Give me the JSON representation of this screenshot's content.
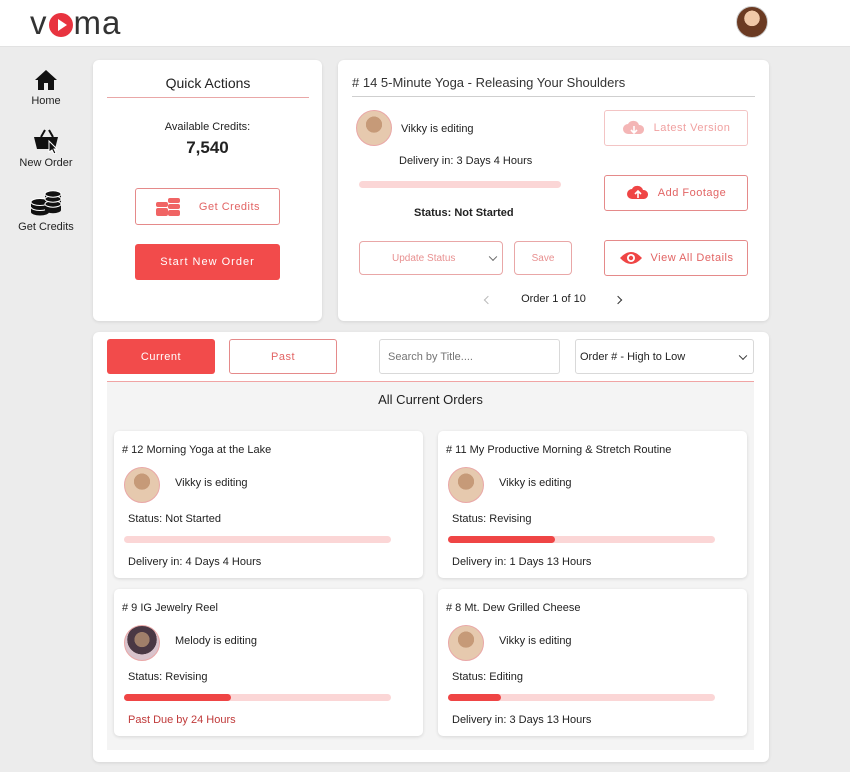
{
  "header": {
    "logo_text": "voma"
  },
  "sidebar": {
    "items": [
      {
        "label": "Home",
        "icon": "home-icon"
      },
      {
        "label": "New Order",
        "icon": "basket-icon"
      },
      {
        "label": "Get Credits",
        "icon": "coins-icon"
      }
    ]
  },
  "quick_actions": {
    "title": "Quick Actions",
    "credits_label": "Available Credits:",
    "credits_value": "7,540",
    "get_credits_label": "Get Credits",
    "start_order_label": "Start New Order"
  },
  "current_order": {
    "title": "# 14  5-Minute Yoga - Releasing Your Shoulders",
    "editor_status": "Vikky is editing",
    "delivery": "Delivery in:  3 Days 4 Hours",
    "progress": 0,
    "status": "Status: Not Started",
    "update_status_label": "Update Status",
    "save_label": "Save",
    "latest_version_label": "Latest Version",
    "add_footage_label": "Add Footage",
    "view_details_label": "View All Details",
    "pager": "Order 1 of 10"
  },
  "orders": {
    "tab_current": "Current",
    "tab_past": "Past",
    "search_placeholder": "Search by Title....",
    "sort_selected": "Order # - High to Low",
    "heading": "All Current Orders",
    "items": [
      {
        "title": "# 12  Morning Yoga at the Lake",
        "editor": "Vikky is editing",
        "status": "Status: Not Started",
        "progress": 0,
        "delivery": "Delivery in:  4 Days 4 Hours",
        "overdue": false
      },
      {
        "title": "# 11  My Productive Morning & Stretch Routine",
        "editor": "Vikky is editing",
        "status": "Status: Revising",
        "progress": 0.4,
        "delivery": "Delivery in:  1 Days 13 Hours",
        "overdue": false
      },
      {
        "title": "# 9  IG Jewelry Reel",
        "editor": "Melody is editing",
        "status": "Status: Revising",
        "progress": 0.4,
        "delivery": "Past Due by 24 Hours",
        "overdue": true
      },
      {
        "title": "# 8  Mt. Dew Grilled Cheese",
        "editor": "Vikky is editing",
        "status": "Status: Editing",
        "progress": 0.2,
        "delivery": "Delivery in:  3 Days 13 Hours",
        "overdue": false
      }
    ]
  },
  "colors": {
    "accent": "#f24b4b",
    "accent_light": "#fbd6d6",
    "overdue": "#c03a3a"
  }
}
